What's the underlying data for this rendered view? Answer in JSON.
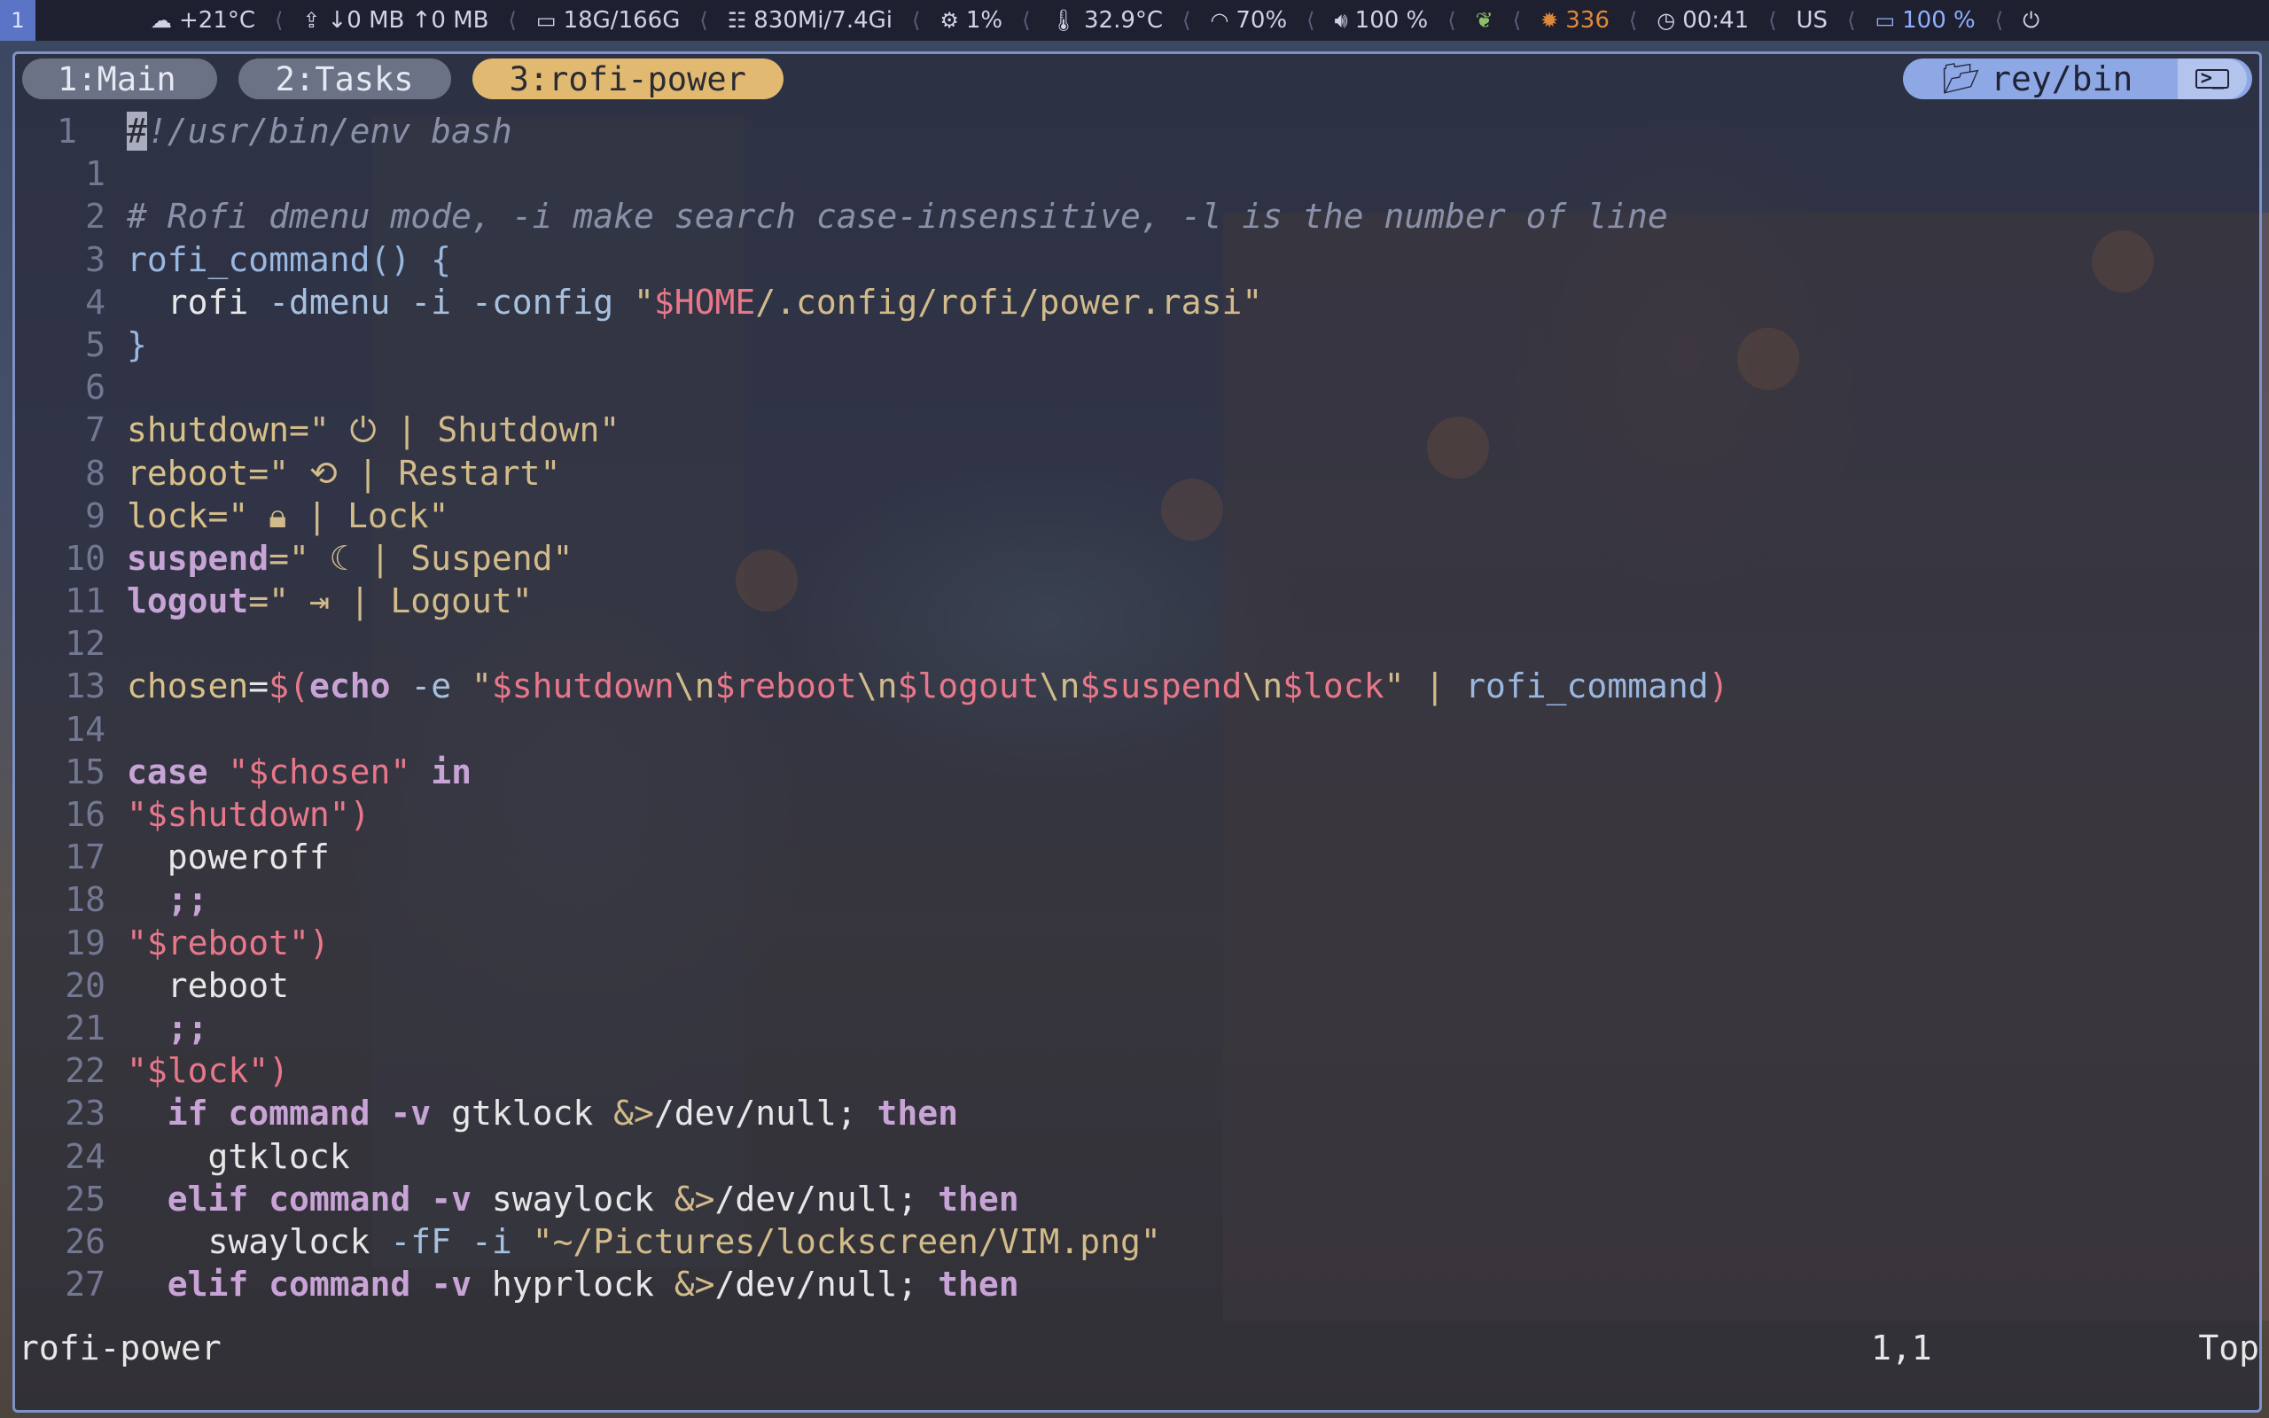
{
  "topbar": {
    "workspace": "1",
    "weather": {
      "icon": "cloud-icon",
      "text": "+21°C"
    },
    "network": {
      "icon": "upload-icon",
      "text": "↓0 MB ↑0 MB"
    },
    "disk": {
      "icon": "disk-icon",
      "text": "18G/166G"
    },
    "memory": {
      "icon": "memory-icon",
      "text": "830Mi/7.4Gi"
    },
    "cpu": {
      "icon": "cpu-icon",
      "text": "1%"
    },
    "temperature": {
      "icon": "thermometer-icon",
      "text": "32.9°C"
    },
    "wifi": {
      "icon": "wifi-icon",
      "text": "70%"
    },
    "volume": {
      "icon": "speaker-icon",
      "text": "100 %"
    },
    "leaf": {
      "icon": "leaf-icon"
    },
    "brightness": {
      "icon": "gear-sun-icon",
      "text": "336"
    },
    "clock": {
      "icon": "clock-icon",
      "text": "00:41"
    },
    "layout": {
      "text": "US"
    },
    "battery": {
      "icon": "battery-icon",
      "text": "100 %"
    },
    "power": {
      "icon": "power-icon"
    },
    "separator": "⟨",
    "colors": {
      "bar_bg": "#1e2030",
      "accent_green": "#8bbf6a",
      "accent_orange": "#e0883a",
      "accent_blue": "#8fb0ff"
    }
  },
  "window": {
    "tabs": [
      {
        "label": "1:Main",
        "active": false
      },
      {
        "label": "2:Tasks",
        "active": false
      },
      {
        "label": "3:rofi-power",
        "active": true
      }
    ],
    "directory": {
      "icon": "folder-icon",
      "label": "rey/bin",
      "terminal_icon": "terminal-icon",
      "terminal_glyph": ">_"
    },
    "colors": {
      "border": "#7e92c8",
      "active_tab": "#e1b970",
      "dir_pill": "#8ea8e6"
    }
  },
  "editor": {
    "line_numbers": [
      "1",
      "1",
      "2",
      "3",
      "4",
      "5",
      "6",
      "7",
      "8",
      "9",
      "10",
      "11",
      "12",
      "13",
      "14",
      "15",
      "16",
      "17",
      "18",
      "19",
      "20",
      "21",
      "22",
      "23",
      "24",
      "25",
      "26",
      "27"
    ],
    "code": {
      "l1_cursor": "#",
      "l1_rest": "!/usr/bin/env bash",
      "l2": "# Rofi dmenu mode, -i make search case-insensitive, -l is the number of line",
      "l3_fn": "rofi_command() {",
      "l4_cmd": "  rofi",
      "l4_opts": " -dmenu -i -config ",
      "l4_q1": "\"",
      "l4_var": "$HOME",
      "l4_path": "/.config/rofi/power.rasi\"",
      "l5": "}",
      "l7_name": "shutdown",
      "l7_val": "=\" ⏻ | Shutdown\"",
      "l8_name": "reboot",
      "l8_val": "=\" ⟲ | Restart\"",
      "l9_name": "lock",
      "l9_val": "=\" 🔒︎ | Lock\"",
      "l10_name": "suspend",
      "l10_val": "=\" ☾ | Suspend\"",
      "l11_name": "logout",
      "l11_val": "=\" ⇥ | Logout\"",
      "l13_name": "chosen",
      "l13_eq": "=",
      "l13_sub": "$(",
      "l13_echo": "echo",
      "l13_opt": " -e ",
      "l13_q": "\"",
      "l13_v1": "$shutdown",
      "l13_e1": "\\n",
      "l13_v2": "$reboot",
      "l13_e2": "\\n",
      "l13_v3": "$logout",
      "l13_e3": "\\n",
      "l13_v4": "$suspend",
      "l13_e4": "\\n",
      "l13_v5": "$lock",
      "l13_q2": "\" | ",
      "l13_fn": "rofi_command",
      "l13_close": ")",
      "l15_case": "case",
      "l15_str": " \"$chosen\" ",
      "l15_in": "in",
      "l16": "\"$shutdown\")",
      "l17": "  poweroff",
      "l18": "  ;;",
      "l19": "\"$reboot\")",
      "l20": "  reboot",
      "l21": "  ;;",
      "l22": "\"$lock\")",
      "l23_if": "  if",
      "l23_cmd": " command",
      "l23_v": " -v",
      "l23_rest": " gtklock ",
      "l23_redir": "&>",
      "l23_dev": "/dev/null",
      "l23_semi": "; ",
      "l23_then": "then",
      "l24": "    gtklock",
      "l25_elif": "  elif",
      "l25_cmd": " command",
      "l25_v": " -v",
      "l25_rest": " swaylock ",
      "l25_redir": "&>",
      "l25_dev": "/dev/null",
      "l25_semi": "; ",
      "l25_then": "then",
      "l26_cmd": "    swaylock",
      "l26_opts": " -fF -i ",
      "l26_str": "\"~/Pictures/lockscreen/VIM.png\"",
      "l27_elif": "  elif",
      "l27_cmd": " command",
      "l27_v": " -v",
      "l27_rest": " hyprlock ",
      "l27_redir": "&>",
      "l27_dev": "/dev/null",
      "l27_semi": "; ",
      "l27_then": "then"
    }
  },
  "statusline": {
    "filename": "rofi-power",
    "position": "1,1",
    "scroll": "Top"
  }
}
